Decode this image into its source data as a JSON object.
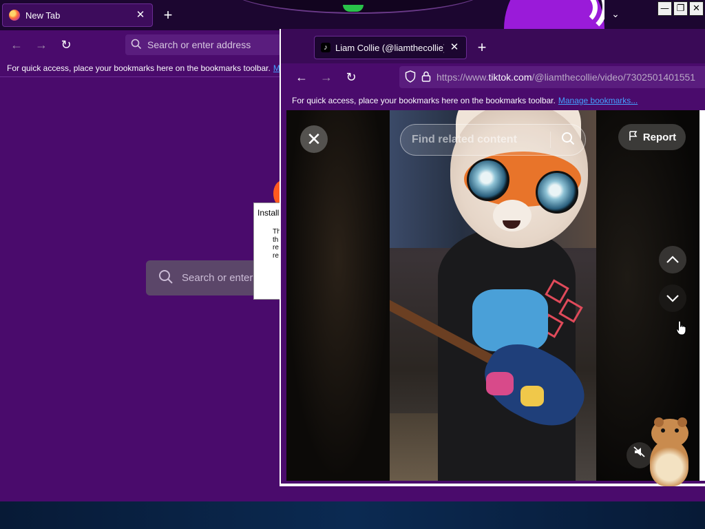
{
  "background_browser": {
    "tab": {
      "title": "New Tab"
    },
    "address_bar": {
      "placeholder": "Search or enter address"
    },
    "bookmarks_bar": {
      "text": "For quick access, place your bookmarks here on the bookmarks toolbar.",
      "link_partial": "Ma"
    },
    "content_search": {
      "placeholder_partial": "Search or enter"
    },
    "install_dialog": {
      "title_partial": "Install",
      "body_lines": [
        "Th",
        "th",
        "re",
        "re"
      ]
    }
  },
  "window_controls": {
    "minimize": "—",
    "maximize": "❐",
    "close": "✕"
  },
  "foreground_browser": {
    "tab": {
      "title": "Liam Collie (@liamthecollie) | T"
    },
    "address_bar": {
      "url_prefix": "https://www.",
      "url_host": "tiktok.com",
      "url_path": "/@liamthecollie/video/7302501401551"
    },
    "bookmarks_bar": {
      "text": "For quick access, place your bookmarks here on the bookmarks toolbar.",
      "link": "Manage bookmarks..."
    }
  },
  "tiktok_viewer": {
    "search": {
      "placeholder": "Find related content"
    },
    "report_label": "Report"
  },
  "colors": {
    "browser_frame": "#4a0b6c",
    "tab_strip": "#1c0630",
    "link": "#45a1ff",
    "taskbar": "#0b2a52"
  },
  "icons": [
    "firefox-logo",
    "tiktok-logo",
    "back-arrow-icon",
    "forward-arrow-icon",
    "reload-icon",
    "search-icon",
    "shield-icon",
    "lock-icon",
    "flag-icon",
    "chevron-up-icon",
    "chevron-down-icon",
    "mute-icon",
    "close-icon",
    "plus-icon"
  ]
}
